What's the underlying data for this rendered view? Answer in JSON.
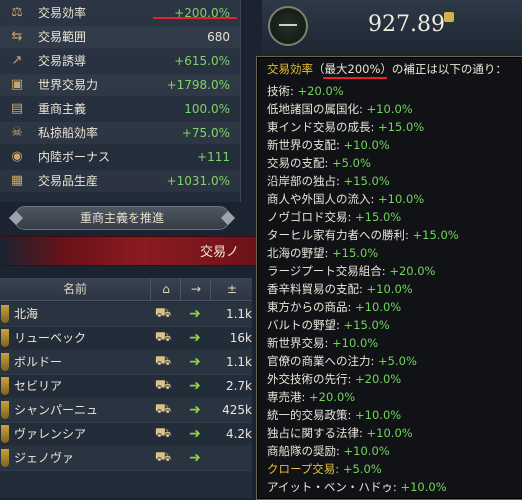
{
  "stats": [
    {
      "icon": "trade-efficiency-icon",
      "glyph": "⚖",
      "label": "交易効率",
      "value": "+200.0%",
      "tone": "pos"
    },
    {
      "icon": "trade-range-icon",
      "glyph": "⇆",
      "label": "交易範囲",
      "value": "680",
      "tone": "neu"
    },
    {
      "icon": "trade-steering-icon",
      "glyph": "↗",
      "label": "交易誘導",
      "value": "+615.0%",
      "tone": "pos"
    },
    {
      "icon": "global-trade-power-icon",
      "glyph": "▣",
      "label": "世界交易力",
      "value": "+1798.0%",
      "tone": "pos"
    },
    {
      "icon": "mercantilism-icon",
      "glyph": "▤",
      "label": "重商主義",
      "value": "100.0%",
      "tone": "pos"
    },
    {
      "icon": "privateer-efficiency-icon",
      "glyph": "☠",
      "label": "私掠船効率",
      "value": "+75.0%",
      "tone": "pos"
    },
    {
      "icon": "inland-bonus-icon",
      "glyph": "◉",
      "label": "内陸ボーナス",
      "value": "+111",
      "tone": "pos"
    },
    {
      "icon": "trade-goods-production-icon",
      "glyph": "▦",
      "label": "交易品生産",
      "value": "+1031.0%",
      "tone": "pos"
    }
  ],
  "promote_button": "重商主義を推進",
  "banner_title": "交易ノ",
  "table": {
    "headers": [
      "名前",
      "⌂",
      "→",
      "±"
    ],
    "rows": [
      {
        "name": "北海",
        "value": "1.1k"
      },
      {
        "name": "リューベック",
        "value": "16k"
      },
      {
        "name": "ボルドー",
        "value": "1.1k"
      },
      {
        "name": "セビリア",
        "value": "2.7k"
      },
      {
        "name": "シャンパーニュ",
        "value": "425k"
      },
      {
        "name": "ヴァレンシア",
        "value": "4.2k"
      },
      {
        "name": "ジェノヴァ",
        "value": ""
      }
    ]
  },
  "money": "927.89",
  "tooltip": {
    "head_gold": "交易効率",
    "head_paren": "（最大200%）",
    "head_rest": "の補正は以下の通り：",
    "lines": [
      {
        "label": "技術: ",
        "value": "+20.0%"
      },
      {
        "label": "低地諸国の属国化: ",
        "value": "+10.0%"
      },
      {
        "label": "東インド交易の成長: ",
        "value": "+15.0%"
      },
      {
        "label": "新世界の支配: ",
        "value": "+10.0%"
      },
      {
        "label": "交易の支配: ",
        "value": "+5.0%"
      },
      {
        "label": "沿岸部の独占: ",
        "value": "+15.0%"
      },
      {
        "label": "商人や外国人の流入: ",
        "value": "+10.0%"
      },
      {
        "label": "ノヴゴロド交易: ",
        "value": "+15.0%"
      },
      {
        "label": "ターヒル家有力者への勝利: ",
        "value": "+15.0%"
      },
      {
        "label": "北海の野望: ",
        "value": "+15.0%"
      },
      {
        "label": "ラージプート交易組合: ",
        "value": "+20.0%"
      },
      {
        "label": "香辛料貿易の支配: ",
        "value": "+10.0%"
      },
      {
        "label": "東方からの商品: ",
        "value": "+10.0%"
      },
      {
        "label": "バルトの野望: ",
        "value": "+15.0%"
      },
      {
        "label": "新世界交易: ",
        "value": "+10.0%"
      },
      {
        "label": "官僚の商業への注力: ",
        "value": "+5.0%"
      },
      {
        "label": "外交技術の先行: ",
        "value": "+20.0%"
      },
      {
        "label": "専売港: ",
        "value": "+20.0%"
      },
      {
        "label": "統一的交易政策: ",
        "value": "+10.0%"
      },
      {
        "label": "独占に関する法律: ",
        "value": "+10.0%"
      },
      {
        "label": "商船隊の奨励: ",
        "value": "+10.0%"
      },
      {
        "label": "クロープ交易: ",
        "value": "+5.0%",
        "gold": true
      },
      {
        "label": "アイット・ベン・ハドゥ: ",
        "value": "+10.0%"
      }
    ]
  }
}
